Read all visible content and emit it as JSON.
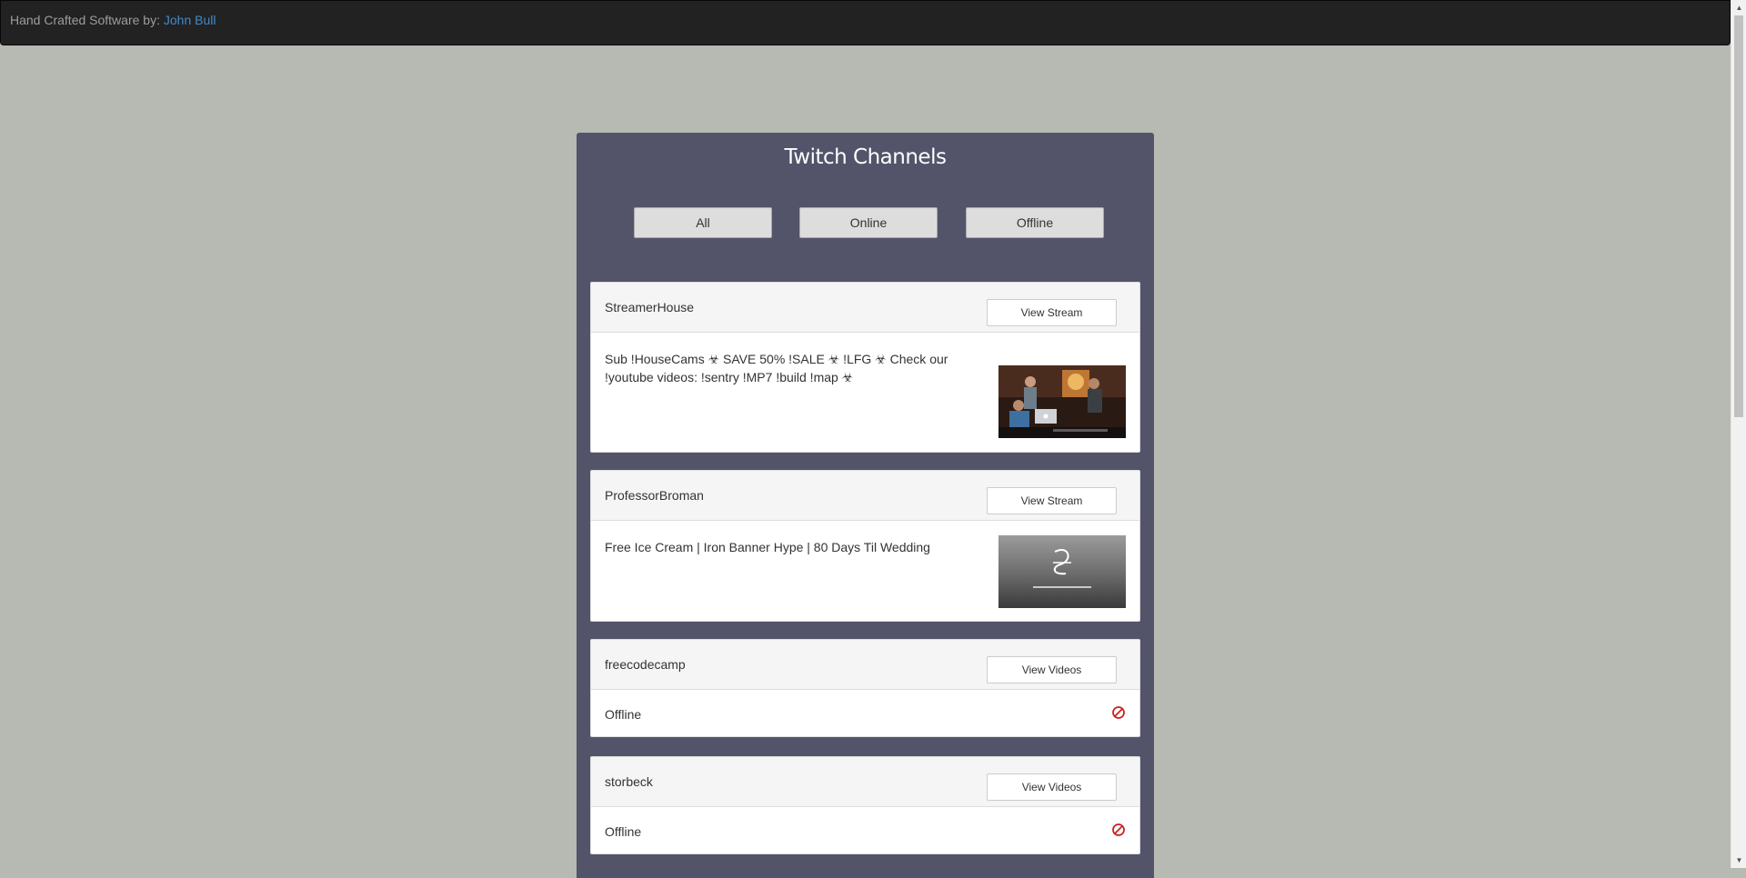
{
  "navbar": {
    "credit_prefix": "Hand Crafted Software by:",
    "author_name": "John Bull"
  },
  "panel": {
    "title": "Twitch Channels"
  },
  "filters": [
    {
      "label": "All"
    },
    {
      "label": "Online"
    },
    {
      "label": "Offline"
    }
  ],
  "channels": [
    {
      "name": "StreamerHouse",
      "button": "View Stream",
      "status": "Sub !HouseCams ☣ SAVE 50% !SALE ☣ !LFG ☣ Check our !youtube videos: !sentry !MP7 !build !map ☣",
      "online": true,
      "preview_icon": "stream-preview-thumbnail"
    },
    {
      "name": "ProfessorBroman",
      "button": "View Stream",
      "status": "Free Ice Cream | Iron Banner Hype | 80 Days Til Wedding",
      "online": true,
      "preview_icon": "channel-logo-thumbnail"
    },
    {
      "name": "freecodecamp",
      "button": "View Videos",
      "status": "Offline",
      "online": false,
      "status_icon": "offline-ban-icon"
    },
    {
      "name": "storbeck",
      "button": "View Videos",
      "status": "Offline",
      "online": false,
      "status_icon": "offline-ban-icon"
    }
  ],
  "colors": {
    "page_background": "#b7b9b3",
    "navbar": "#222222",
    "panel": "#53546a",
    "author_link": "#428bca",
    "offline_icon": "#cc2222"
  }
}
